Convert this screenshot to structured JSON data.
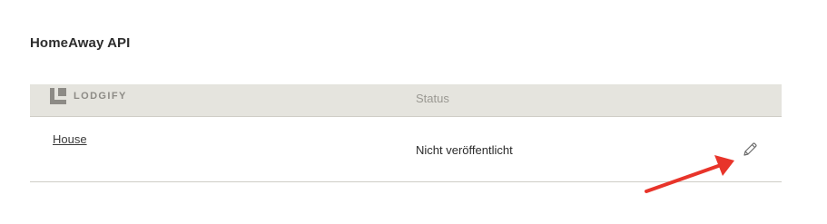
{
  "section": {
    "title": "HomeAway API"
  },
  "table": {
    "brand_name": "LODGIFY",
    "brand_icon": "lodgify-logo-icon",
    "status_header": "Status",
    "rows": [
      {
        "property": "House",
        "status": "Nicht veröffentlicht",
        "action_icon": "pencil-edit-icon"
      }
    ]
  },
  "annotation": {
    "arrow_icon": "arrow-icon",
    "arrow_color": "#e8342a"
  },
  "colors": {
    "header_background": "#e5e4de",
    "divider": "#cfcdc6",
    "muted_text": "#9a9892"
  }
}
